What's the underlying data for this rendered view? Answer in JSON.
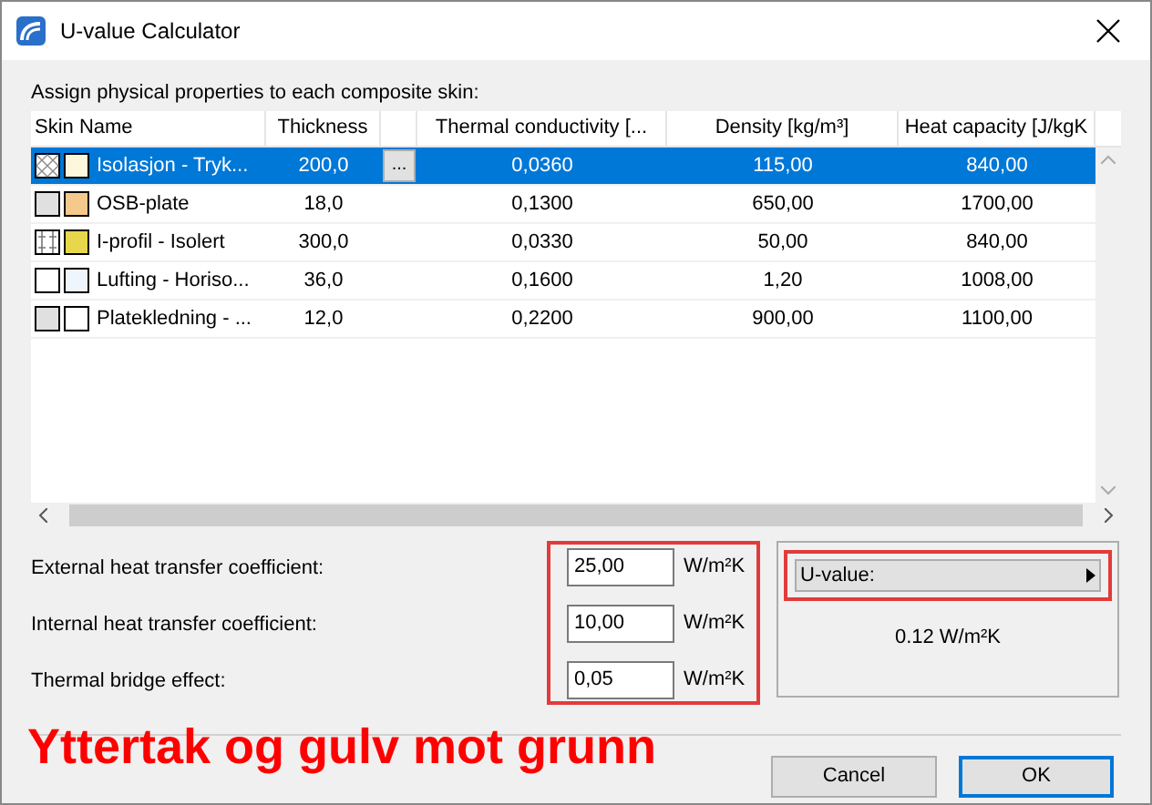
{
  "window": {
    "title": "U-value Calculator"
  },
  "instruction": "Assign physical properties to each composite skin:",
  "table": {
    "columns": [
      "Skin Name",
      "Thickness",
      "Thermal conductivity [...",
      "Density [kg/m³]",
      "Heat capacity [J/kgK"
    ],
    "rows": [
      {
        "kind": "cross",
        "color": "#fdf7dc",
        "name": "Isolasjon - Tryk...",
        "thickness": "200,0",
        "button": "...",
        "conductivity": "0,0360",
        "density": "115,00",
        "heat_capacity": "840,00",
        "selected": true
      },
      {
        "kind": "dots",
        "color": "#f5c98c",
        "name": "OSB-plate",
        "thickness": "18,0",
        "conductivity": "0,1300",
        "density": "650,00",
        "heat_capacity": "1700,00",
        "selected": false
      },
      {
        "kind": "iprofile",
        "color": "#e6d84a",
        "name": "I-profil - Isolert",
        "thickness": "300,0",
        "conductivity": "0,0330",
        "density": "50,00",
        "heat_capacity": "840,00",
        "selected": false
      },
      {
        "kind": "none",
        "color": "#eef5fc",
        "name": "Lufting - Horiso...",
        "thickness": "36,0",
        "conductivity": "0,1600",
        "density": "1,20",
        "heat_capacity": "1008,00",
        "selected": false
      },
      {
        "kind": "dots",
        "color": "#ffffff",
        "name": "Platekledning - ...",
        "thickness": "12,0",
        "conductivity": "0,2200",
        "density": "900,00",
        "heat_capacity": "1100,00",
        "selected": false
      }
    ]
  },
  "fields": [
    {
      "label": "External heat transfer coefficient:",
      "value": "25,00",
      "unit": "W/m²K"
    },
    {
      "label": "Internal heat transfer coefficient:",
      "value": "10,00",
      "unit": "W/m²K"
    },
    {
      "label": "Thermal bridge effect:",
      "value": "0,05",
      "unit": "W/m²K"
    }
  ],
  "result": {
    "label": "U-value:",
    "value": "0.12 W/m²K"
  },
  "annotation": "Yttertak og gulv mot grunn",
  "buttons": [
    "Cancel",
    "OK"
  ]
}
